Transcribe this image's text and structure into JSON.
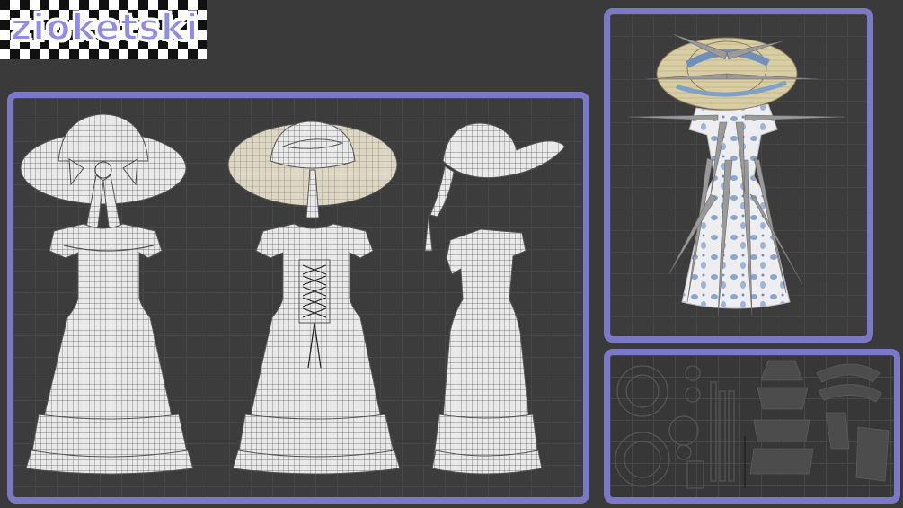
{
  "logo": {
    "text": "zioketski"
  },
  "colors": {
    "background": "#3a3a3a",
    "panel_border": "#7b78c6",
    "logo_text": "#8e8ce8",
    "wire_fill": "#e8e8e8",
    "wire_line": "#6a6a6a",
    "hat_inner": "#dcd4bc",
    "print_blue": "#7e9cc4"
  },
  "panels": {
    "wireframe_views": [
      "front",
      "back",
      "side"
    ],
    "render": "textured-preview",
    "uv": "uv-layout"
  }
}
